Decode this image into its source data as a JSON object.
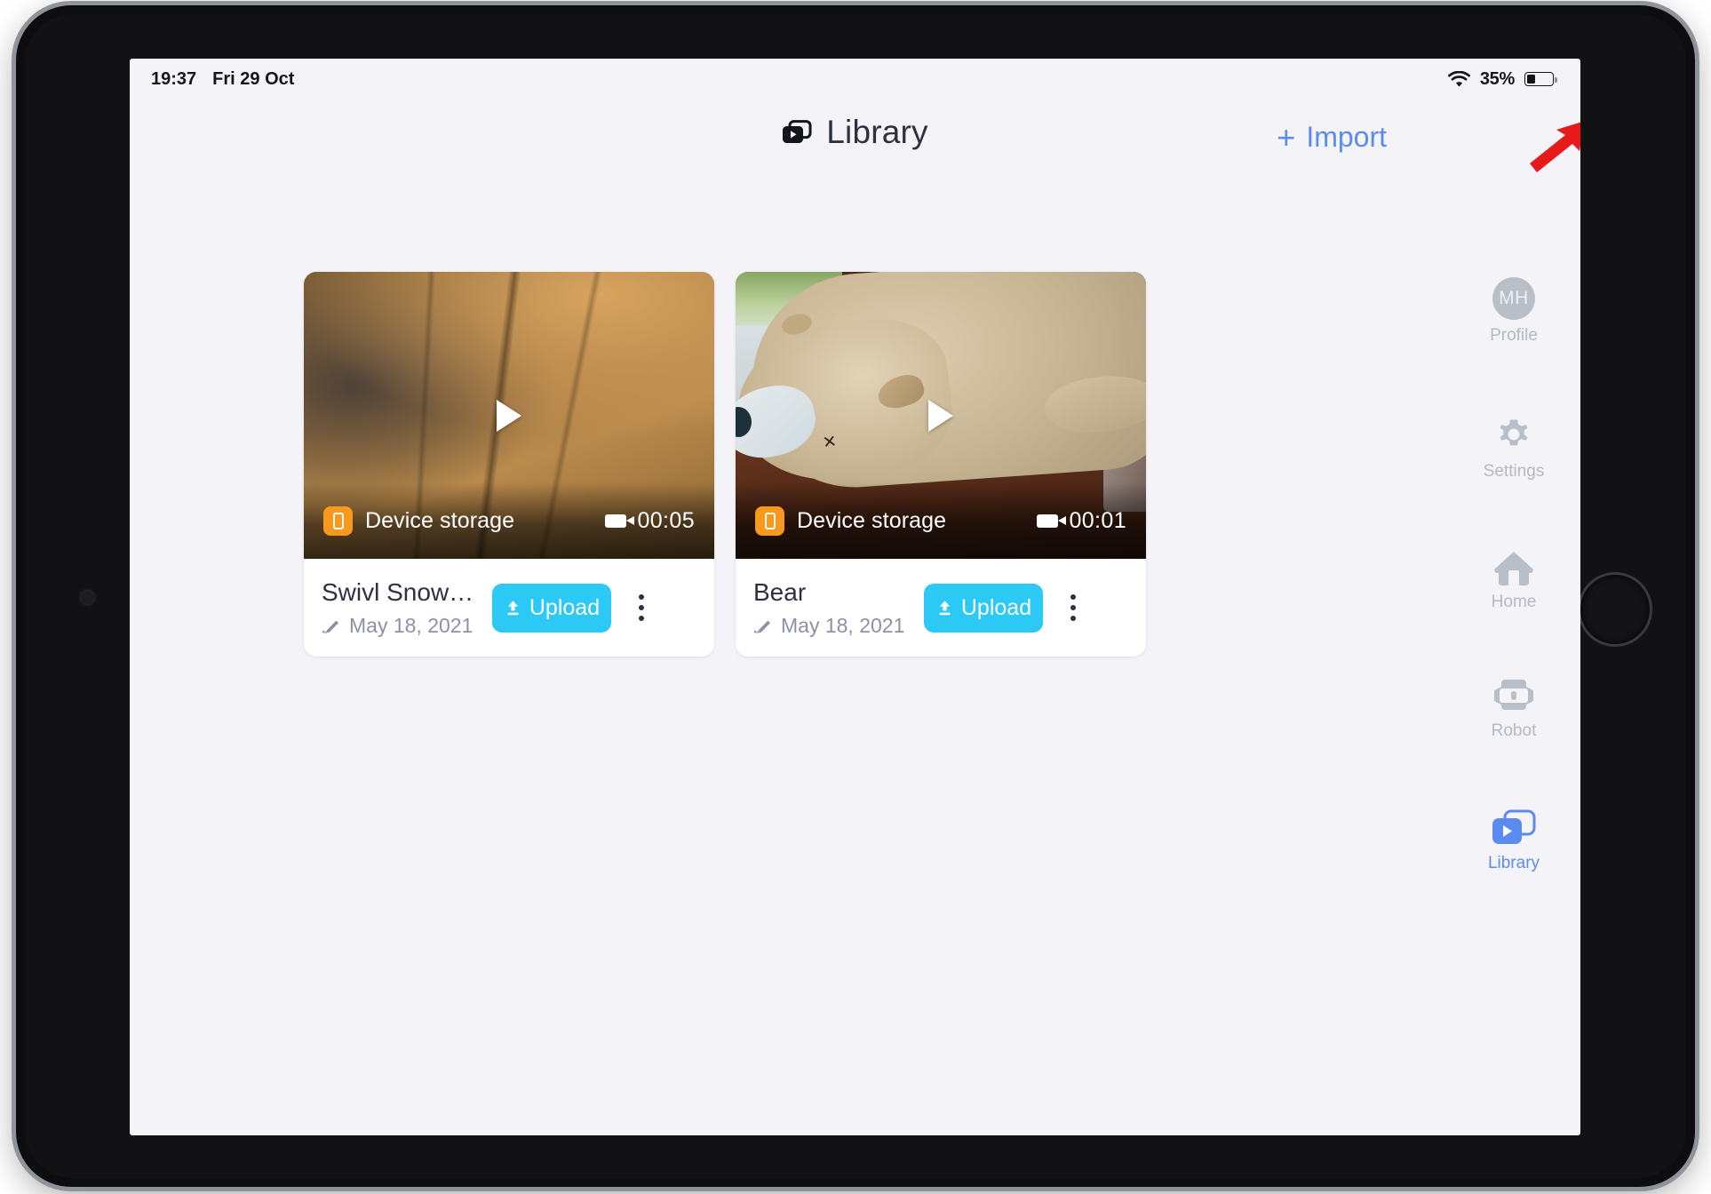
{
  "status_bar": {
    "time": "19:37",
    "date": "Fri 29 Oct",
    "wifi_icon": "wifi-icon",
    "battery_percent": "35%",
    "battery_level": 35
  },
  "header": {
    "title": "Library",
    "title_icon": "library-stack-icon",
    "import_label": "Import",
    "import_plus": "+",
    "import_color": "#5a8cf0"
  },
  "cards": [
    {
      "storage_label": "Device storage",
      "storage_icon": "phone-icon",
      "duration": "00:05",
      "duration_icon": "video-camera-icon",
      "title": "Swivl Snowbo...",
      "date": "May 18, 2021",
      "date_icon": "pencil-icon",
      "upload_label": "Upload",
      "upload_icon": "upload-arrow-icon",
      "menu_icon": "kebab-menu-icon",
      "play_icon": "play-icon"
    },
    {
      "storage_label": "Device storage",
      "storage_icon": "phone-icon",
      "duration": "00:01",
      "duration_icon": "video-camera-icon",
      "title": "Bear",
      "date": "May 18, 2021",
      "date_icon": "pencil-icon",
      "upload_label": "Upload",
      "upload_icon": "upload-arrow-icon",
      "menu_icon": "kebab-menu-icon",
      "play_icon": "play-icon"
    }
  ],
  "sidebar": {
    "items": [
      {
        "label": "Profile",
        "icon": "avatar-icon",
        "initials": "MH",
        "active": false
      },
      {
        "label": "Settings",
        "icon": "gear-icon",
        "active": false
      },
      {
        "label": "Home",
        "icon": "home-icon",
        "active": false
      },
      {
        "label": "Robot",
        "icon": "robot-icon",
        "active": false
      },
      {
        "label": "Library",
        "icon": "library-stack-icon",
        "active": true
      }
    ],
    "active_color": "#5a8cf0",
    "inactive_color": "#b4b9c4"
  },
  "annotation": {
    "arrow_icon": "red-arrow-icon",
    "arrow_color": "#e8191b"
  },
  "colors": {
    "page_background": "#f4f4f8",
    "card_background": "#ffffff",
    "upload_button": "#2bc9f4",
    "storage_badge": "#f8991d",
    "text_primary": "#2d3142",
    "text_muted": "#8b92a3"
  }
}
